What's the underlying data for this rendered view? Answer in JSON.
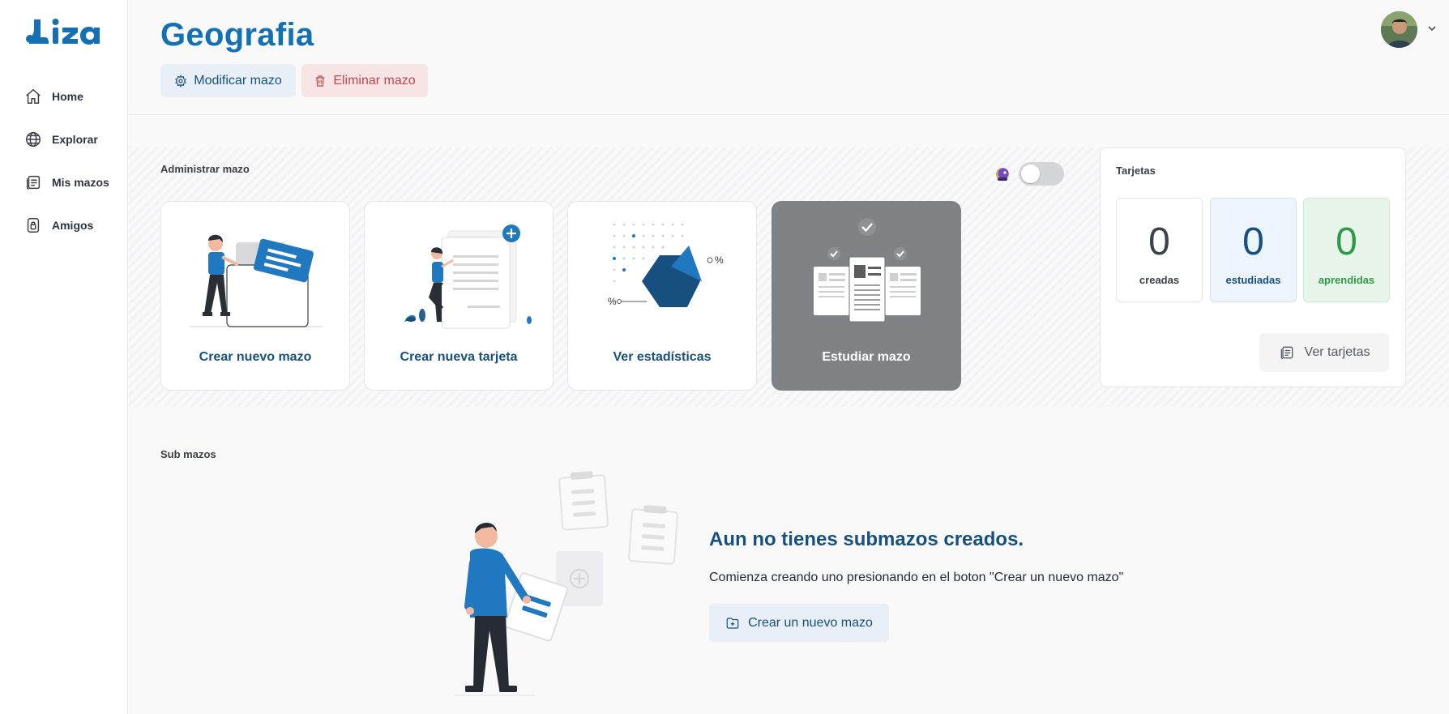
{
  "app": {
    "logo_text": "Liza"
  },
  "sidebar": {
    "items": [
      {
        "label": "Home",
        "icon": "home-icon"
      },
      {
        "label": "Explorar",
        "icon": "globe-icon"
      },
      {
        "label": "Mis mazos",
        "icon": "cards-icon"
      },
      {
        "label": "Amigos",
        "icon": "lock-icon"
      }
    ]
  },
  "header": {
    "title": "Geografia",
    "modify_label": "Modificar mazo",
    "delete_label": "Eliminar mazo"
  },
  "manage": {
    "section_label": "Administrar mazo",
    "toggle_on": false,
    "actions": [
      {
        "label": "Crear nuevo mazo"
      },
      {
        "label": "Crear nueva tarjeta"
      },
      {
        "label": "Ver estadísticas"
      },
      {
        "label": "Estudiar mazo"
      }
    ]
  },
  "cards_panel": {
    "title": "Tarjetas",
    "stats": [
      {
        "value": "0",
        "caption": "creadas"
      },
      {
        "value": "0",
        "caption": "estudiadas"
      },
      {
        "value": "0",
        "caption": "aprendidas"
      }
    ],
    "view_label": "Ver tarjetas"
  },
  "submazos": {
    "section_label": "Sub mazos",
    "empty_title": "Aun no tienes submazos creados.",
    "empty_desc": "Comienza creando uno presionando en el boton \"Crear un nuevo mazo\"",
    "new_button_label": "Crear un nuevo mazo"
  },
  "colors": {
    "brand_blue": "#1371b3",
    "dark_blue": "#17507f",
    "danger": "#c2444c",
    "success": "#2e9a47"
  }
}
